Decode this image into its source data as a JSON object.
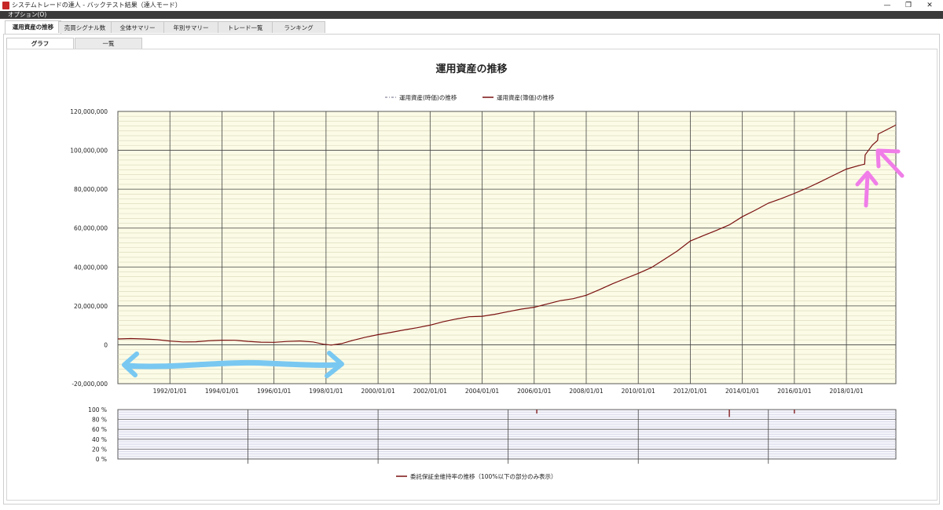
{
  "window": {
    "title": "システムトレードの達人 - バックテスト結果（達人モード）",
    "minimize_glyph": "—",
    "restore_glyph": "❐",
    "close_glyph": "✕"
  },
  "menu": {
    "options_label": "オプション(O)"
  },
  "tabs": [
    {
      "label": "運用資産の推移",
      "active": true
    },
    {
      "label": "売買シグナル数",
      "active": false
    },
    {
      "label": "全体サマリー",
      "active": false
    },
    {
      "label": "年別サマリー",
      "active": false
    },
    {
      "label": "トレード一覧",
      "active": false
    },
    {
      "label": "ランキング",
      "active": false
    }
  ],
  "subtabs": [
    {
      "label": "グラフ",
      "active": true
    },
    {
      "label": "一覧",
      "active": false
    }
  ],
  "chart_data": [
    {
      "type": "line",
      "title": "運用資産の推移",
      "legend": [
        {
          "name": "運用資産(時価)の推移",
          "color": "#6b6b8a",
          "style": "dash-dot"
        },
        {
          "name": "運用資産(簿価)の推移",
          "color": "#7a1010",
          "style": "solid"
        }
      ],
      "legend_position": "top-center",
      "y_ticks": [
        "120,000,000",
        "100,000,000",
        "80,000,000",
        "60,000,000",
        "40,000,000",
        "20,000,000",
        "0",
        "-20,000,000"
      ],
      "ylim": [
        -20000000,
        120000000
      ],
      "x_ticks": [
        "1992/01/01",
        "1994/01/01",
        "1996/01/01",
        "1998/01/01",
        "2000/01/01",
        "2002/01/01",
        "2004/01/01",
        "2006/01/01",
        "2008/01/01",
        "2010/01/01",
        "2012/01/01",
        "2014/01/01",
        "2016/01/01",
        "2018/01/01"
      ],
      "xlim": [
        1990.0,
        2019.9
      ],
      "grid": true,
      "background": "#fbfbe6",
      "series": [
        {
          "name": "運用資産(簿価)の推移",
          "x": [
            1990.0,
            1990.5,
            1991.0,
            1991.5,
            1992.0,
            1992.5,
            1993.0,
            1993.5,
            1994.0,
            1994.5,
            1995.0,
            1995.5,
            1996.0,
            1996.5,
            1997.0,
            1997.5,
            1997.9,
            1998.2,
            1998.6,
            1999.0,
            1999.5,
            2000.0,
            2000.5,
            2001.0,
            2001.5,
            2002.0,
            2002.5,
            2003.0,
            2003.5,
            2004.0,
            2004.5,
            2005.0,
            2005.5,
            2006.0,
            2006.5,
            2007.0,
            2007.5,
            2008.0,
            2008.5,
            2009.0,
            2009.5,
            2010.0,
            2010.5,
            2011.0,
            2011.5,
            2012.0,
            2012.5,
            2013.0,
            2013.5,
            2014.0,
            2014.5,
            2015.0,
            2015.5,
            2016.0,
            2016.5,
            2017.0,
            2017.5,
            2018.0,
            2018.5,
            2018.7,
            2018.72,
            2019.0,
            2019.2,
            2019.22,
            2019.5,
            2019.9
          ],
          "values": [
            3000000,
            2900000,
            2700000,
            2600000,
            2200000,
            1800000,
            1600000,
            1800000,
            2000000,
            2200000,
            2000000,
            1700000,
            1400000,
            1500000,
            1600000,
            1300000,
            500000,
            200000,
            800000,
            2000000,
            3500000,
            5000000,
            6500000,
            8000000,
            9000000,
            10000000,
            11500000,
            13000000,
            14500000,
            15000000,
            16000000,
            17000000,
            18000000,
            19000000,
            21000000,
            23000000,
            24000000,
            25500000,
            28000000,
            31000000,
            34000000,
            37000000,
            40000000,
            44000000,
            48000000,
            53000000,
            56000000,
            59000000,
            62000000,
            66000000,
            69000000,
            72500000,
            75000000,
            78000000,
            81000000,
            84000000,
            87000000,
            90000000,
            92000000,
            93000000,
            98000000,
            103000000,
            105000000,
            108000000,
            110000000,
            113000000
          ]
        }
      ]
    },
    {
      "type": "bar",
      "legend": [
        {
          "name": "委託保証金維持率の推移（100%以下の部分のみ表示）",
          "color": "#7a1010"
        }
      ],
      "y_ticks": [
        "100 %",
        "80 %",
        "60 %",
        "40 %",
        "20 %",
        "0 %"
      ],
      "ylim": [
        0,
        100
      ],
      "xlim": [
        1990.0,
        2019.9
      ],
      "series": [
        {
          "name": "委託保証金維持率の推移（100%以下の部分のみ表示）",
          "x": [
            2006.1,
            2013.5,
            2016.0
          ],
          "values": [
            92,
            85,
            92
          ]
        }
      ]
    }
  ],
  "annotations": {
    "blue_arrow_color": "#79c8f2",
    "pink_arrow_color": "#f07de8"
  }
}
